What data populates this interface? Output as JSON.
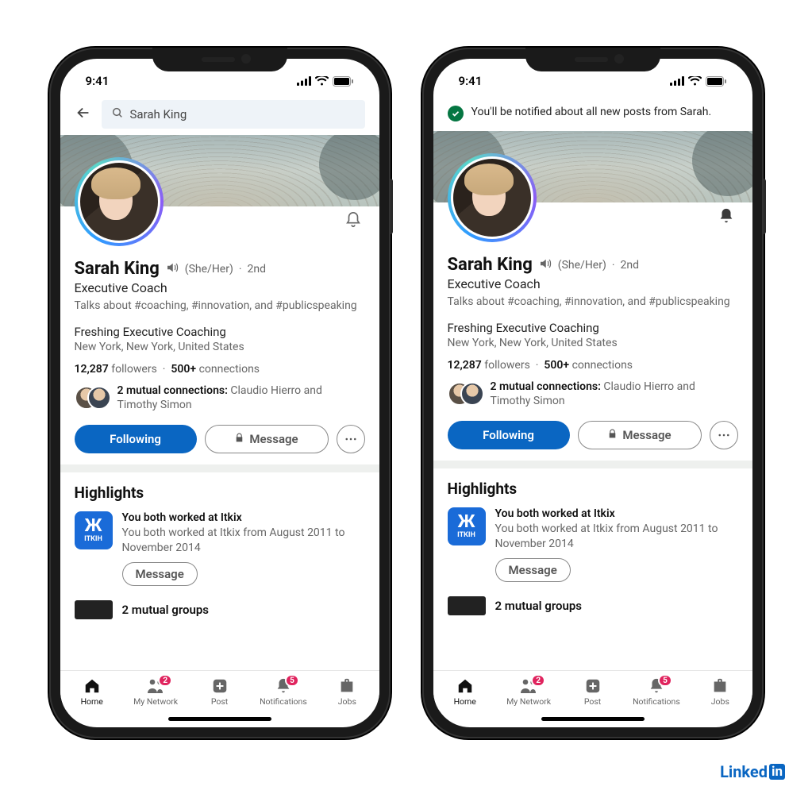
{
  "status": {
    "time": "9:41"
  },
  "search": {
    "query": "Sarah King"
  },
  "toast": {
    "text": "You'll be notified about all new posts from Sarah."
  },
  "profile": {
    "name": "Sarah King",
    "pronouns": "(She/Her)",
    "degree": "2nd",
    "headline": "Executive Coach",
    "talks": "Talks about #coaching, #innovation, and #publicspeaking",
    "company": "Freshing Executive Coaching",
    "location": "New York, New York, United States",
    "followers": "12,287",
    "followers_label": "followers",
    "connections": "500+",
    "connections_label": "connections",
    "mutual_label": "2 mutual connections:",
    "mutual_names": "Claudio Hierro and Timothy Simon"
  },
  "actions": {
    "follow": "Following",
    "message": "Message"
  },
  "highlights": {
    "title": "Highlights",
    "item_logo": "ITKIH",
    "item_title": "You both worked at Itkix",
    "item_sub": "You both worked at Itkix from August 2011 to November 2014",
    "item_btn": "Message",
    "next_title": "2 mutual groups"
  },
  "tabs": {
    "home": "Home",
    "network": "My Network",
    "network_badge": "2",
    "post": "Post",
    "notifications": "Notifications",
    "notifications_badge": "5",
    "jobs": "Jobs"
  },
  "brand": {
    "text": "Linked",
    "suffix": "in"
  }
}
